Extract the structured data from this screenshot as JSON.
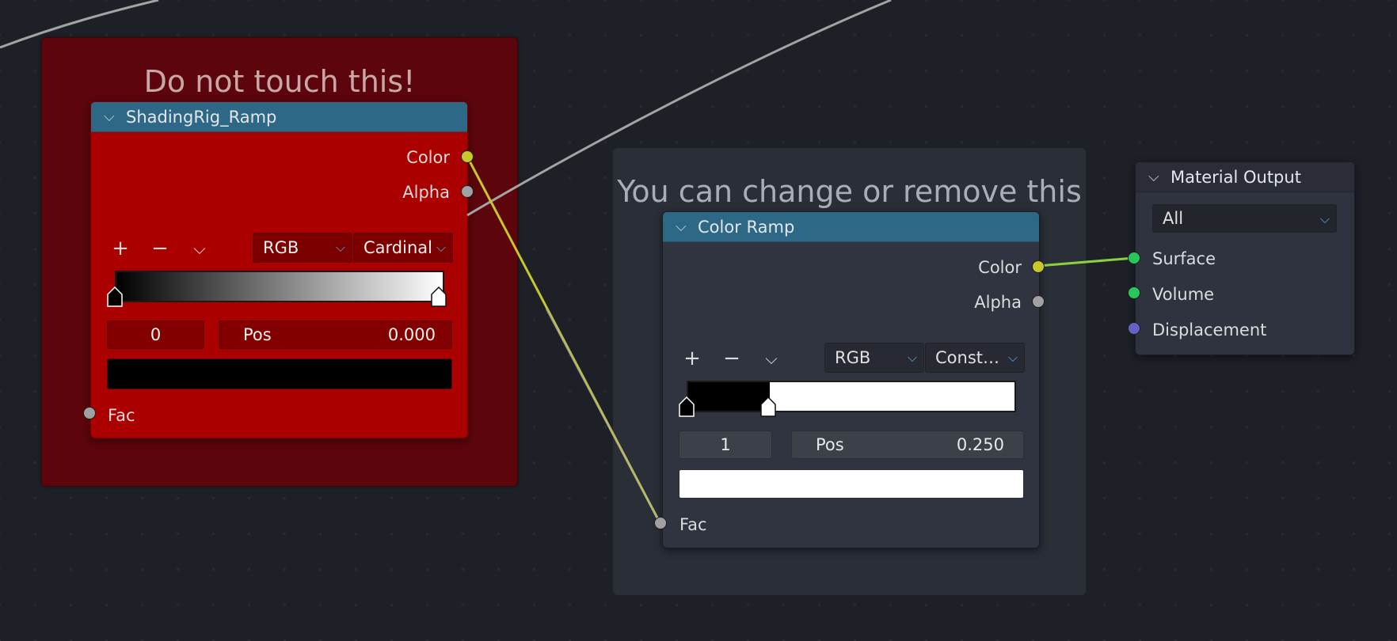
{
  "frames": {
    "protected_label": "Do not touch this!",
    "editable_label": "You can change or remove this"
  },
  "shading_node": {
    "title": "ShadingRig_Ramp",
    "outputs": [
      "Color",
      "Alpha"
    ],
    "inputs": [
      "Fac"
    ],
    "color_mode": "RGB",
    "interpolation": "Cardinal",
    "active_stop_index": "0",
    "pos_label": "Pos",
    "pos_value": "0.000",
    "active_color": "#000000",
    "ramp": {
      "type": "gradient",
      "from": "#000000",
      "to": "#ffffff",
      "stops": [
        0.0,
        1.0
      ]
    }
  },
  "colorramp_node": {
    "title": "Color Ramp",
    "outputs": [
      "Color",
      "Alpha"
    ],
    "inputs": [
      "Fac"
    ],
    "color_mode": "RGB",
    "interpolation": "Const…",
    "active_stop_index": "1",
    "pos_label": "Pos",
    "pos_value": "0.250",
    "active_color": "#ffffff",
    "ramp": {
      "type": "constant",
      "from": "#000000",
      "to": "#ffffff",
      "stops": [
        0.0,
        0.25
      ]
    }
  },
  "output_node": {
    "title": "Material Output",
    "target": "All",
    "inputs": [
      "Surface",
      "Volume",
      "Displacement"
    ]
  },
  "icons": {
    "add": "+",
    "remove": "−",
    "specials": "⌵",
    "collapse": "⌵",
    "dropdown": "⌵"
  },
  "socket_colors": {
    "color": "#c7c729",
    "float": "#a1a1a1",
    "shader": "#27c75c",
    "vector": "#6363c7"
  }
}
